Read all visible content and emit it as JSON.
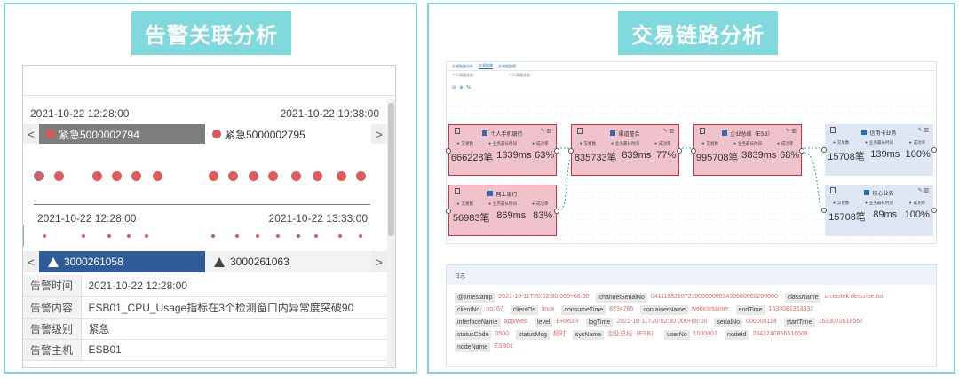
{
  "left": {
    "title": "告警关联分析",
    "timeline_start": "2021-10-22  12:28:00",
    "timeline_end": "2021-10-22  19:38:00",
    "tab_prev": "<",
    "tab_next": ">",
    "alarm_tabs": [
      {
        "label": "紧急5000002794",
        "active": true
      },
      {
        "label": "紧急5000002795",
        "active": false
      }
    ],
    "axis_start": "2021-10-22  12:28:00",
    "axis_end": "2021-10-22  13:33:00",
    "alarm_tabs2": [
      {
        "label": "3000261058",
        "active": true
      },
      {
        "label": "3000261063",
        "active": false
      }
    ],
    "details": [
      {
        "key": "告警时间",
        "value": "2021-10-22  12:28:00"
      },
      {
        "key": "告警内容",
        "value": "ESB01_CPU_Usage指标在3个检测窗口内异常度突破90"
      },
      {
        "key": "告警级别",
        "value": "紧急"
      },
      {
        "key": "告警主机",
        "value": "ESB01"
      }
    ]
  },
  "right": {
    "title": "交易链路分析",
    "flow_tabs": [
      "交易链路分析",
      "交易链路",
      "交易链路图"
    ],
    "flow_sub": [
      "个人网银业务",
      "个人网银业务"
    ],
    "metric_labels": [
      "交易数",
      "业务最长时间",
      "成功率"
    ],
    "nodes": [
      {
        "id": "n1",
        "name": "个人手机银行",
        "count": "666228笔",
        "latency": "1339ms",
        "rate": "63%",
        "style": "red"
      },
      {
        "id": "n2",
        "name": "网上银行",
        "count": "56983笔",
        "latency": "869ms",
        "rate": "83%",
        "style": "red"
      },
      {
        "id": "n3",
        "name": "渠道整合",
        "count": "835733笔",
        "latency": "839ms",
        "rate": "77%",
        "style": "red"
      },
      {
        "id": "n4",
        "name": "企业总线（ESB）",
        "count": "995708笔",
        "latency": "3839ms",
        "rate": "68%",
        "style": "red"
      },
      {
        "id": "n5",
        "name": "信用卡业务",
        "count": "15708笔",
        "latency": "139ms",
        "rate": "100%",
        "style": "blue"
      },
      {
        "id": "n6",
        "name": "核心业务",
        "count": "15708笔",
        "latency": "89ms",
        "rate": "100%",
        "style": "blue"
      }
    ],
    "log_title": "日志",
    "log_rows": [
      [
        {
          "k": "@timestamp",
          "v": "2021-10-11T20:02:30.000+08:00"
        },
        {
          "k": "channelSerialNo",
          "v": "0411183210721000000003450680000200000"
        },
        {
          "k": "className",
          "v": "cn.ecitek.describe.no"
        }
      ],
      [
        {
          "k": "clientNo",
          "v": "no167"
        },
        {
          "k": "clientOs",
          "v": "linux"
        },
        {
          "k": "consumeTime",
          "v": "8734765"
        },
        {
          "k": "containerName",
          "v": "webcontainer"
        },
        {
          "k": "endTime",
          "v": "1633081353332"
        }
      ],
      [
        {
          "k": "interfaceName",
          "v": "app/web"
        },
        {
          "k": "level",
          "v": "ERROR"
        },
        {
          "k": "logTime",
          "v": "2021-10-11T20:02:30.000+08:00"
        },
        {
          "k": "serialNo",
          "v": "000000114"
        },
        {
          "k": "startTime",
          "v": "1633072618567"
        }
      ],
      [
        {
          "k": "statusCode",
          "v": "0500"
        },
        {
          "k": "statusMsg",
          "v": "超时"
        },
        {
          "k": "sysName",
          "v": "企业总线（ESB）"
        },
        {
          "k": "userNo",
          "v": "1000001"
        },
        {
          "k": "nodeId",
          "v": "2843740856516608"
        }
      ],
      [
        {
          "k": "nodeName",
          "v": "ESB01"
        }
      ]
    ]
  },
  "colors": {
    "accent": "#7fd9dd",
    "alarm_red": "#e05a5a",
    "tab_active_blue": "#2e5d9a",
    "node_red_fill": "#f0c2cb",
    "node_red_border": "#d92e3c",
    "node_blue_fill": "#dfe6f3"
  }
}
